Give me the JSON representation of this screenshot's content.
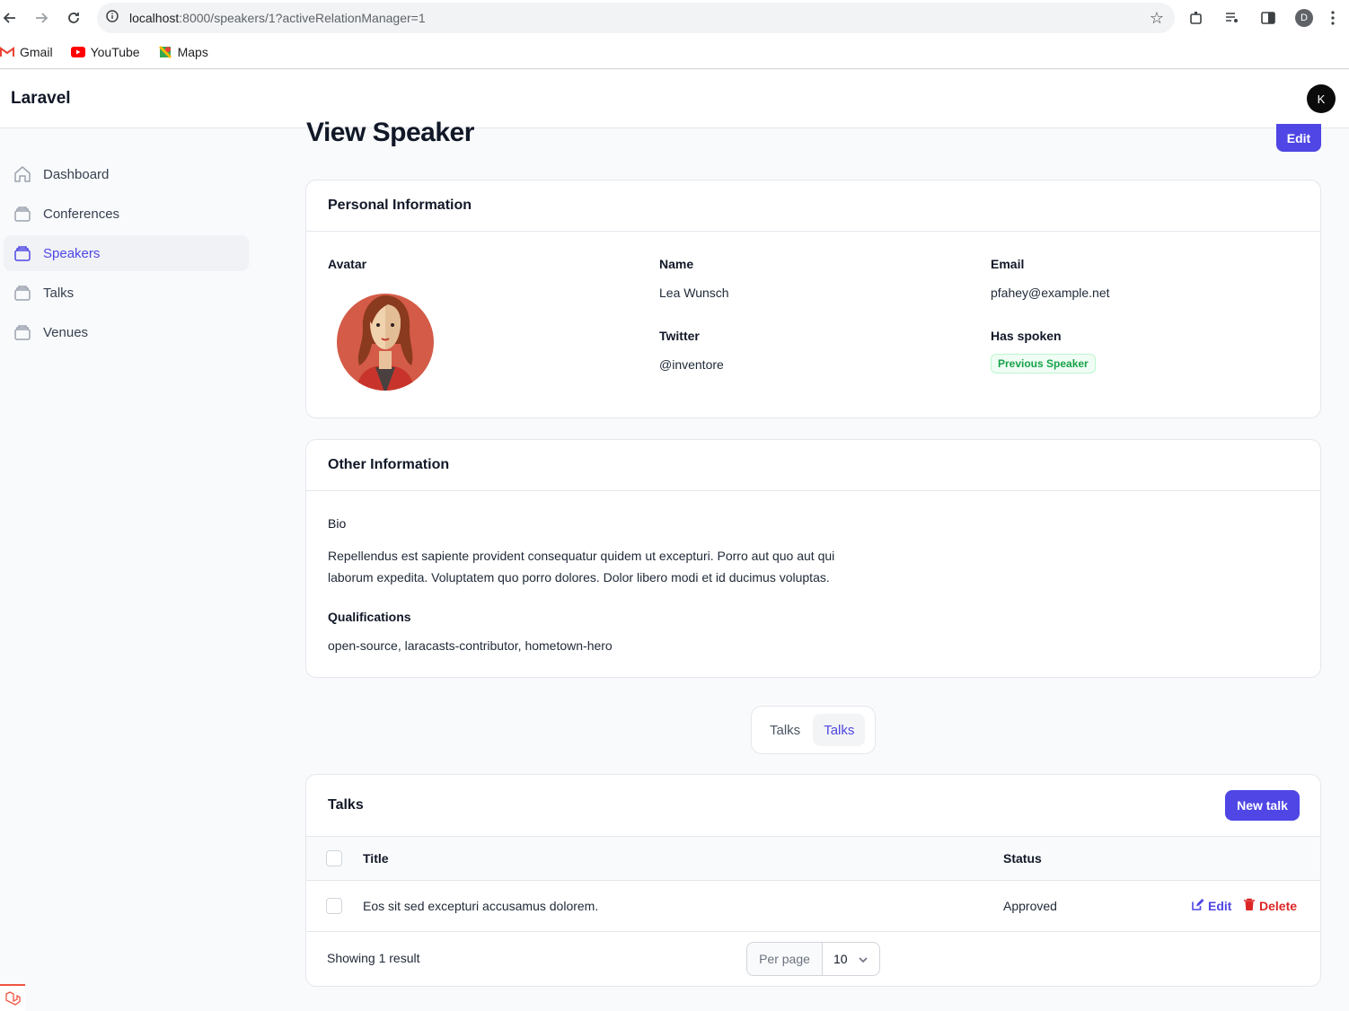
{
  "browser": {
    "url_host": "localhost",
    "url_path": ":8000/speakers/1?activeRelationManager=1",
    "profile_initial": "D",
    "bookmarks": [
      {
        "label": "Gmail",
        "icon": "gmail-icon"
      },
      {
        "label": "YouTube",
        "icon": "youtube-icon"
      },
      {
        "label": "Maps",
        "icon": "maps-icon"
      }
    ]
  },
  "app": {
    "brand": "Laravel",
    "user_initial": "K"
  },
  "sidebar": {
    "items": [
      {
        "label": "Dashboard",
        "icon": "home-icon",
        "active": false
      },
      {
        "label": "Conferences",
        "icon": "stack-icon",
        "active": false
      },
      {
        "label": "Speakers",
        "icon": "stack-icon",
        "active": true
      },
      {
        "label": "Talks",
        "icon": "stack-icon",
        "active": false
      },
      {
        "label": "Venues",
        "icon": "stack-icon",
        "active": false
      }
    ]
  },
  "page": {
    "title": "View Speaker",
    "edit_label": "Edit"
  },
  "personal": {
    "heading": "Personal Information",
    "avatar_label": "Avatar",
    "name_label": "Name",
    "name_value": "Lea Wunsch",
    "email_label": "Email",
    "email_value": "pfahey@example.net",
    "twitter_label": "Twitter",
    "twitter_value": "@inventore",
    "has_spoken_label": "Has spoken",
    "has_spoken_value": "Previous Speaker"
  },
  "other": {
    "heading": "Other Information",
    "bio_label": "Bio",
    "bio_line1": "Repellendus est sapiente provident consequatur quidem ut excepturi. Porro aut quo aut qui",
    "bio_line2": "laborum expedita. Voluptatem quo porro dolores. Dolor libero modi et id ducimus voluptas.",
    "qualifications_label": "Qualifications",
    "qualifications_value": "open-source, laracasts-contributor, hometown-hero"
  },
  "tabs": [
    {
      "label": "Talks",
      "active": false
    },
    {
      "label": "Talks",
      "active": true
    }
  ],
  "talks": {
    "heading": "Talks",
    "new_label": "New talk",
    "columns": [
      "Title",
      "Status"
    ],
    "rows": [
      {
        "title": "Eos sit sed excepturi accusamus dolorem.",
        "status": "Approved"
      }
    ],
    "edit_label": "Edit",
    "delete_label": "Delete",
    "summary": "Showing 1 result",
    "per_page_label": "Per page",
    "per_page_value": "10"
  },
  "colors": {
    "primary": "#4f46e5",
    "danger": "#dc2626",
    "success": "#16a34a"
  }
}
